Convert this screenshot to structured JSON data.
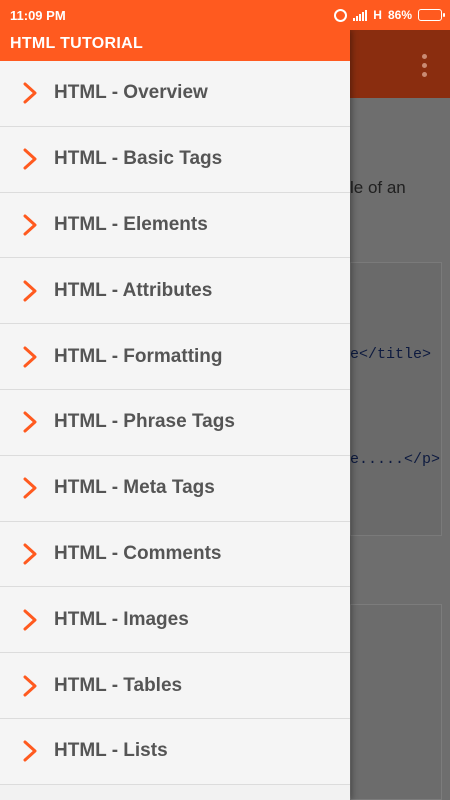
{
  "status_bar": {
    "time": "11:09 PM",
    "network_label": "H",
    "battery_text": "86%",
    "battery_level": 0.86,
    "icons": [
      "alarm-icon",
      "signal-icon",
      "battery-icon"
    ]
  },
  "drawer": {
    "title": "HTML TUTORIAL",
    "items": [
      {
        "label": "HTML - Overview"
      },
      {
        "label": "HTML - Basic Tags"
      },
      {
        "label": "HTML - Elements"
      },
      {
        "label": "HTML - Attributes"
      },
      {
        "label": "HTML - Formatting"
      },
      {
        "label": "HTML - Phrase Tags"
      },
      {
        "label": "HTML - Meta Tags"
      },
      {
        "label": "HTML - Comments"
      },
      {
        "label": "HTML - Images"
      },
      {
        "label": "HTML - Tables"
      },
      {
        "label": "HTML - Lists"
      }
    ]
  },
  "background_page": {
    "text_fragment": "le of an",
    "code_fragments": [
      "e</title>",
      "e.....</p>"
    ]
  },
  "colors": {
    "accent": "#ff5a1f",
    "chevron": "#ff5a1f",
    "item_text": "#555555",
    "scrim": "#6e6e6e"
  }
}
